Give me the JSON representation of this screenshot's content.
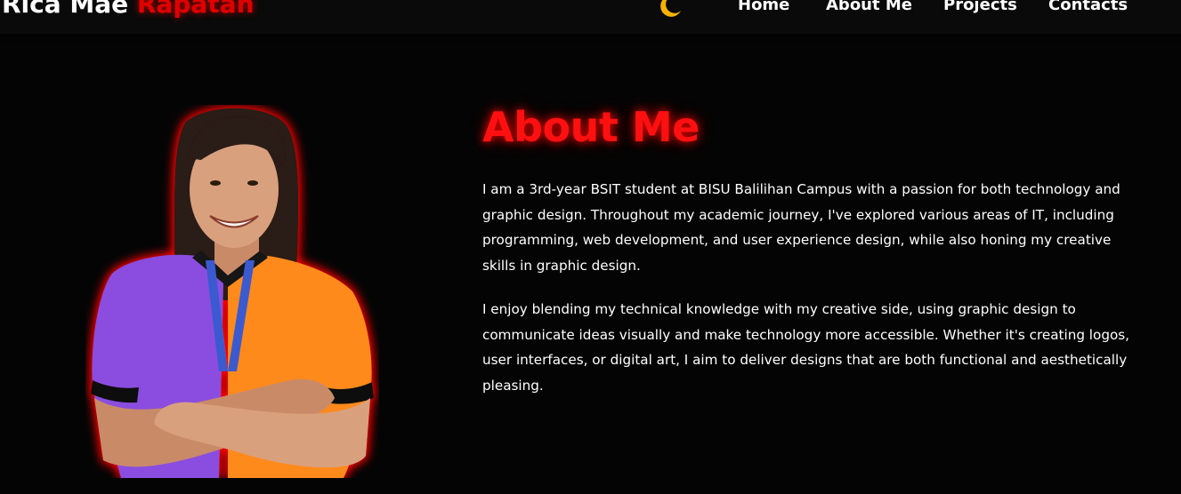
{
  "brand": {
    "first_name": "Rica Mae",
    "last_name": "Rapatan"
  },
  "nav": {
    "theme_toggle_icon": "moon-icon",
    "links": [
      {
        "label": "Home"
      },
      {
        "label": "About Me"
      },
      {
        "label": "Projects"
      },
      {
        "label": "Contacts"
      }
    ]
  },
  "about": {
    "title": "About Me",
    "paragraphs": [
      "I am a 3rd-year BSIT student at BISU Balilihan Campus with a passion for both technology and graphic design. Throughout my academic journey, I've explored various areas of IT, including programming, web development, and user experience design, while also honing my creative skills in graphic design.",
      "I enjoy blending my technical knowledge with my creative side, using graphic design to communicate ideas visually and make technology more accessible. Whether it's creating logos, user interfaces, or digital art, I aim to deliver designs that are both functional and aesthetically pleasing."
    ]
  },
  "colors": {
    "background": "#040404",
    "accent_red": "#ff1010",
    "moon_yellow": "#f5b301",
    "text": "#ffffff"
  }
}
